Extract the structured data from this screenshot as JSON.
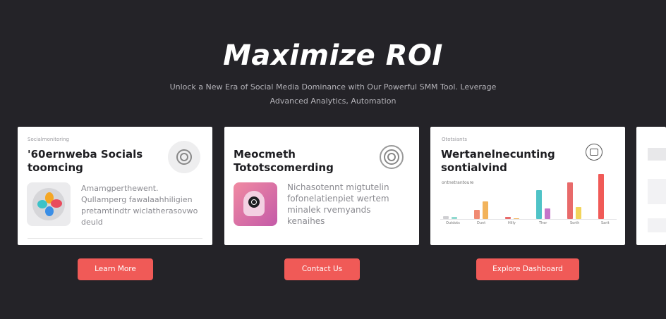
{
  "hero": {
    "title": "Maximize ROI",
    "subtitle": "Unlock a New Era of Social Media Dominance with Our Powerful SMM Tool. Leverage Advanced Analytics, Automation"
  },
  "cards": [
    {
      "caption": "Socialmonitoring",
      "title": "'60ernweba Socials toomcing",
      "text": "Amamgperthewent. Qullamperg fawalaahhiligien pretamtindtr wiclatherasovwo deuld",
      "icon": "color-petals-icon",
      "badge_icon": "spiral-icon",
      "button": "Learn More"
    },
    {
      "caption": "",
      "title": "Meocmeth Tototscomerding",
      "text": "Nichasotennt migtutelin fofonelatienpiet wertem minalek rvemyands kenaihes",
      "icon": "head-gear-icon",
      "badge_icon": "spiral-icon",
      "button": "Contact Us"
    },
    {
      "caption": "Ototsiants",
      "title": "Wertanelnecunting sontialvind",
      "legend": "ontnetrantoure",
      "icon": "robot-icon",
      "button": "Explore Dashboard",
      "colors": [
        "#f05a57",
        "#4fc3c7",
        "#f2b35b",
        "#c475c9"
      ]
    }
  ],
  "chart_data": {
    "type": "bar",
    "categories": [
      "Outdots",
      "Dunt",
      "Hilly",
      "Ther",
      "Sorth",
      "Sarit"
    ],
    "series": [
      {
        "values": [
          1.5,
          4.5,
          1.0,
          14,
          18,
          22
        ]
      },
      {
        "values": [
          1.0,
          8.5,
          0.5,
          5,
          6,
          0
        ]
      }
    ],
    "ylim": [
      0,
      24
    ],
    "grid": false
  }
}
